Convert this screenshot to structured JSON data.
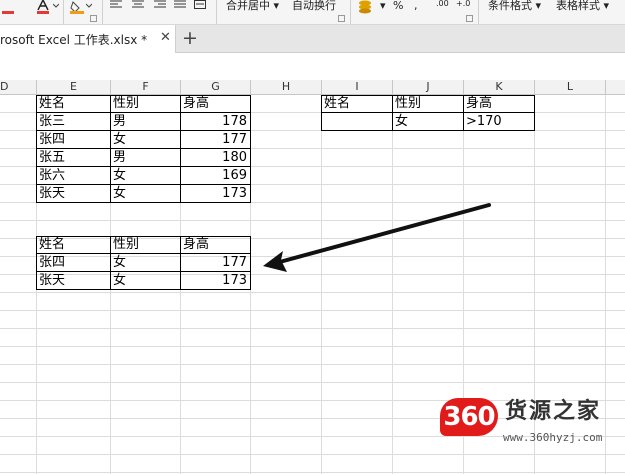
{
  "ribbon": {
    "merge_center_label": "合并居中",
    "wrap_text_label": "自动换行",
    "percent_label": "%",
    "decimal_increase_label": ".00",
    "decimal_decrease_label": "+.0",
    "conditional_format_label": "条件格式",
    "table_style_label": "表格样式",
    "icons": [
      "font-color-icon",
      "fill-color-icon",
      "align-left-icon",
      "align-center-icon",
      "align-right-icon",
      "justify-icon",
      "distributed-icon",
      "number-format-icon",
      "percent-icon",
      "comma-icon"
    ]
  },
  "tab": {
    "title": "rosoft Excel 工作表.xlsx *",
    "close_glyph": "✕",
    "new_glyph": "+"
  },
  "columns": [
    "D",
    "E",
    "F",
    "G",
    "H",
    "I",
    "J",
    "K",
    "L"
  ],
  "source_table": {
    "headers": [
      "姓名",
      "性别",
      "身高"
    ],
    "rows": [
      [
        "张三",
        "男",
        "178"
      ],
      [
        "张四",
        "女",
        "177"
      ],
      [
        "张五",
        "男",
        "180"
      ],
      [
        "张六",
        "女",
        "169"
      ],
      [
        "张天",
        "女",
        "173"
      ]
    ]
  },
  "criteria": {
    "headers": [
      "姓名",
      "性别",
      "身高"
    ],
    "values": [
      "",
      "女",
      ">170"
    ]
  },
  "result_table": {
    "headers": [
      "姓名",
      "性别",
      "身高"
    ],
    "rows": [
      [
        "张四",
        "女",
        "177"
      ],
      [
        "张天",
        "女",
        "173"
      ]
    ]
  },
  "watermark": {
    "logo_number": "360",
    "brand": "货源之家",
    "url": "www.360hyzj.com"
  },
  "colors": {
    "ribbon_bg": "#f5f5f5",
    "grid_line": "#dcdcdc",
    "header_bg": "#f2f2f2",
    "watermark_red": "#e11a1a",
    "font_color_red": "#e53935",
    "fill_color_orange": "#f39c12"
  }
}
